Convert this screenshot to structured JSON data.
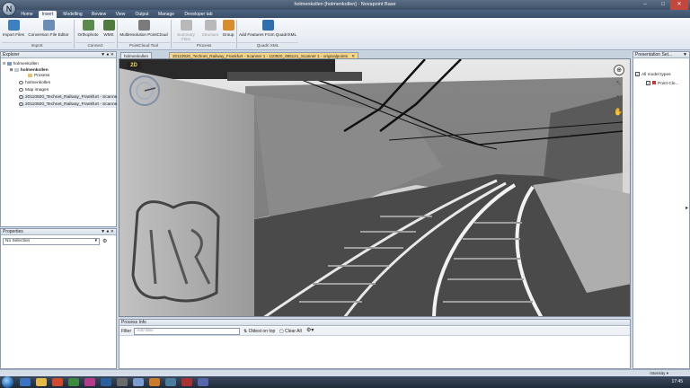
{
  "window": {
    "title": "holmenkollen [holmenkollen] - Novapoint Base",
    "app_button": "N"
  },
  "ribbon_tabs": [
    {
      "label": "Home",
      "active": false
    },
    {
      "label": "Insert",
      "active": true
    },
    {
      "label": "Modelling",
      "active": false
    },
    {
      "label": "Review",
      "active": false
    },
    {
      "label": "View",
      "active": false
    },
    {
      "label": "Output",
      "active": false
    },
    {
      "label": "Manage",
      "active": false
    },
    {
      "label": "Developer tab",
      "active": false
    }
  ],
  "ribbon": {
    "buttons": [
      {
        "label": "Import Files",
        "icon": "import-files-icon",
        "color": "#3b7fc4",
        "enabled": true
      },
      {
        "label": "Conversion File Editor",
        "icon": "conversion-file-editor-icon",
        "color": "#6a8db5",
        "enabled": true
      },
      {
        "label": "Orthophoto",
        "icon": "orthophoto-icon",
        "color": "#5c8a4e",
        "enabled": true
      },
      {
        "label": "WMS",
        "icon": "wms-icon",
        "color": "#4f7b3f",
        "enabled": true
      },
      {
        "label": "Multiresolution PointCloud",
        "icon": "pointcloud-icon",
        "color": "#7b7b7b",
        "enabled": true
      },
      {
        "label": "Summary Files",
        "icon": "summary-files-icon",
        "color": "#b9b9b9",
        "enabled": false
      },
      {
        "label": "Structure",
        "icon": "structure-icon",
        "color": "#b9b9b9",
        "enabled": false
      },
      {
        "label": "Group",
        "icon": "group-icon",
        "color": "#d98c2b",
        "enabled": true
      },
      {
        "label": "Add Features From QuadriXML",
        "icon": "quadri-xml-icon",
        "color": "#2f6fb0",
        "enabled": true
      }
    ],
    "groups": [
      "Import",
      "Connect",
      "PointCloud Tool",
      "Process",
      "Quadri XML"
    ]
  },
  "explorer": {
    "title": "Explorer",
    "items": [
      {
        "label": "holmenkollen",
        "icon": "project-icon"
      },
      {
        "label": "holmenkollen",
        "icon": "model-icon"
      },
      {
        "label": "Prosess",
        "icon": "folder-icon"
      },
      {
        "label": "holmenkollen",
        "icon": "terrain-icon"
      },
      {
        "label": "Map images",
        "icon": "map-images-icon"
      },
      {
        "label": "20110920_Technet_Railway_Frankfurt - Scanne...",
        "icon": "pointcloud-item-icon"
      },
      {
        "label": "20110920_Technet_Railway_Frankfurt - Scanne...",
        "icon": "pointcloud-item-icon"
      }
    ]
  },
  "properties": {
    "title": "Properties",
    "selection": "No Selection"
  },
  "document_tabs": [
    {
      "label": "holmenkollen",
      "active": false
    },
    {
      "label": "20110920_Technet_Railway_Frankfurt - Scanner 1 - 110920_085121_Scanner 1 - originalpoints",
      "active": true
    }
  ],
  "viewport": {
    "scale_badge": "2D"
  },
  "process_info": {
    "title": "Process Info",
    "filter_label": "Filter",
    "filter_placeholder": "Add filter",
    "oldest_on_top": "Oldest on top",
    "clear_all": "Clear All"
  },
  "presentation": {
    "title": "Presentation Set...",
    "items": [
      {
        "label": "All model types",
        "checked": true
      },
      {
        "label": "Point Clo...",
        "checked": true
      }
    ]
  },
  "statusbar": {
    "intensity": "Intensity"
  },
  "taskbar": {
    "clock": "17:45"
  },
  "colors": {
    "accent_tab": "#f7d68a",
    "title_bar": "#3e5066"
  }
}
